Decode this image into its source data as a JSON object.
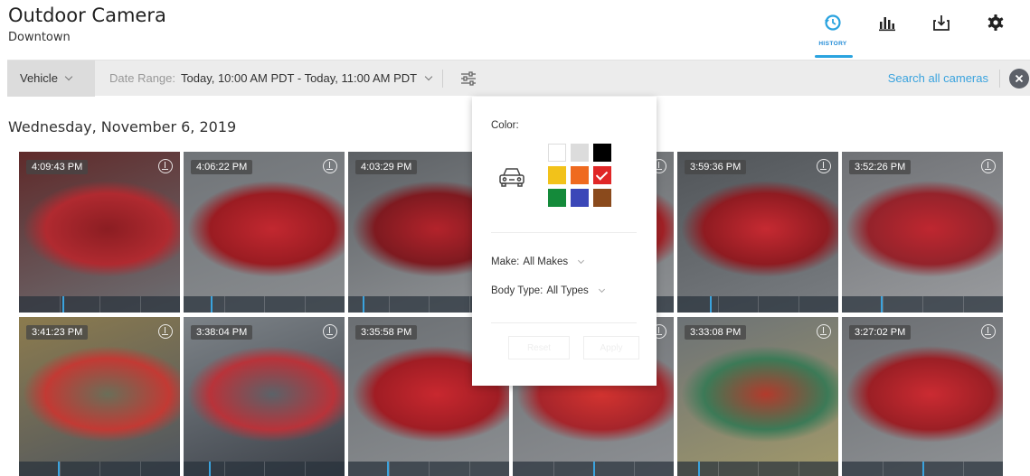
{
  "header": {
    "title": "Outdoor Camera",
    "subtitle": "Downtown",
    "nav": [
      {
        "id": "history",
        "label": "HISTORY",
        "icon": "history-icon",
        "active": true
      },
      {
        "id": "analytics",
        "label": "",
        "icon": "bar-chart-icon",
        "active": false
      },
      {
        "id": "export",
        "label": "",
        "icon": "export-icon",
        "active": false
      },
      {
        "id": "settings",
        "label": "",
        "icon": "gear-icon",
        "active": false
      }
    ]
  },
  "toolbar": {
    "object_type": "Vehicle",
    "date_range_label": "Date Range:",
    "date_range_value": "Today, 10:00 AM PDT - Today, 11:00 AM PDT",
    "search_all": "Search all cameras"
  },
  "results": {
    "date_heading": "Wednesday, November 6, 2019",
    "tiles": [
      {
        "time": "4:09:43 PM"
      },
      {
        "time": "4:06:22 PM"
      },
      {
        "time": "4:03:29 PM"
      },
      {
        "time": ""
      },
      {
        "time": "3:59:36 PM"
      },
      {
        "time": "3:52:26 PM"
      },
      {
        "time": "3:41:23 PM"
      },
      {
        "time": "3:38:04 PM"
      },
      {
        "time": "3:35:58 PM"
      },
      {
        "time": ""
      },
      {
        "time": "3:33:08 PM"
      },
      {
        "time": "3:27:02 PM"
      }
    ]
  },
  "filter_popup": {
    "color_label": "Color:",
    "colors": [
      {
        "hex": "#ffffff",
        "checked": false
      },
      {
        "hex": "#dcdcdc",
        "checked": false
      },
      {
        "hex": "#000000",
        "checked": false
      },
      {
        "hex": "#f2c21a",
        "checked": false
      },
      {
        "hex": "#ef6a1f",
        "checked": false
      },
      {
        "hex": "#e02727",
        "checked": true
      },
      {
        "hex": "#148a3a",
        "checked": false
      },
      {
        "hex": "#3b47b8",
        "checked": false
      },
      {
        "hex": "#8a4a1c",
        "checked": false
      }
    ],
    "make_label": "Make:",
    "make_value": "All Makes",
    "body_type_label": "Body Type:",
    "body_type_value": "All Types",
    "reset_label": "Reset",
    "apply_label": "Apply"
  },
  "colors": {
    "accent": "#2aa3df",
    "toolbar_bg": "#ececec",
    "timeline_marker": "#3aa3de"
  }
}
